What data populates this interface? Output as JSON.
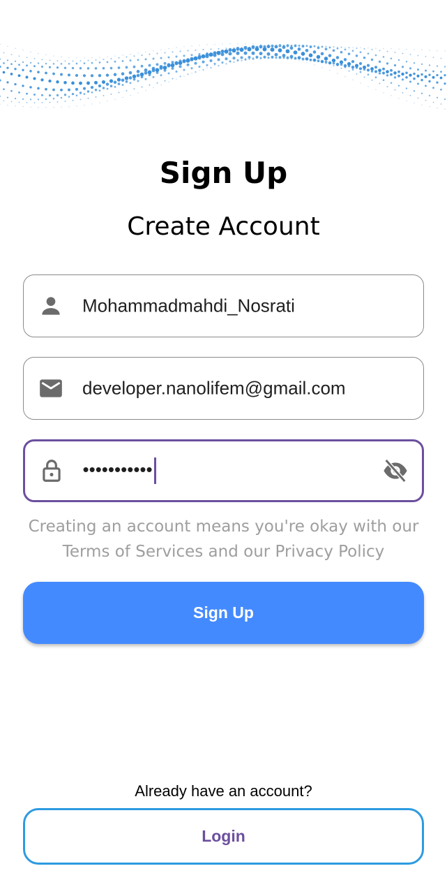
{
  "colors": {
    "primary": "#448aff",
    "focus": "#6b4f9e",
    "outline": "#8a8a8a",
    "login_border": "#2d9be0",
    "hint": "#9e9e9e",
    "wave_dot": "#3a8fd9"
  },
  "header": {
    "title": "Sign Up",
    "subtitle": "Create Account"
  },
  "form": {
    "username": {
      "icon": "person-icon",
      "value": "Mohammadmahdi_Nosrati"
    },
    "email": {
      "icon": "mail-icon",
      "value": "developer.nanolifem@gmail.com"
    },
    "password": {
      "icon": "lock-icon",
      "value": "•••••••••••",
      "toggle_icon": "eye-off-icon",
      "focused": true
    }
  },
  "legal": {
    "line1": "Creating an account means you're okay with our",
    "line2": "Terms of Services and our Privacy Policy"
  },
  "actions": {
    "signup_label": "Sign Up",
    "already_text": "Already have an account?",
    "login_label": "Login"
  }
}
